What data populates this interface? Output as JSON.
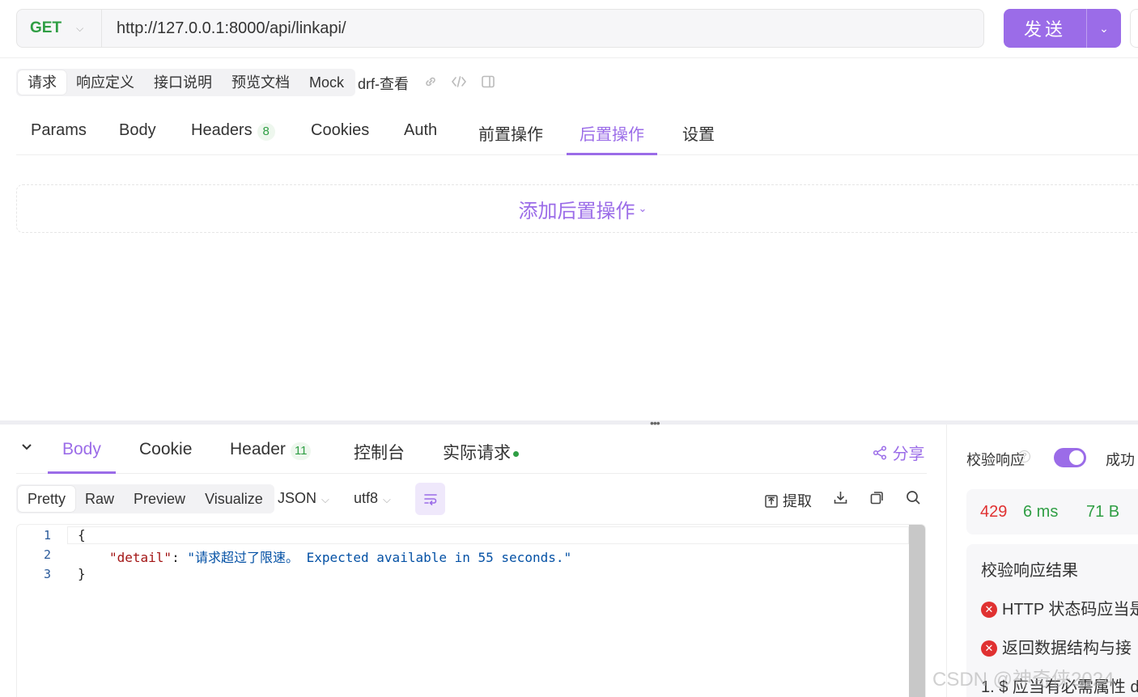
{
  "request": {
    "method": "GET",
    "url": "http://127.0.0.1:8000/api/linkapi/",
    "send_label": "发送"
  },
  "modes": [
    "请求",
    "响应定义",
    "接口说明",
    "预览文档",
    "Mock"
  ],
  "doc_name": "drf-查看",
  "req_tabs": {
    "params": "Params",
    "body": "Body",
    "headers": "Headers",
    "headers_count": "8",
    "cookies": "Cookies",
    "auth": "Auth",
    "pre": "前置操作",
    "post": "后置操作",
    "settings": "设置"
  },
  "add_post_action": "添加后置操作",
  "res_tabs": {
    "body": "Body",
    "cookie": "Cookie",
    "header": "Header",
    "header_count": "11",
    "console": "控制台",
    "actual": "实际请求",
    "share": "分享"
  },
  "views": [
    "Pretty",
    "Raw",
    "Preview",
    "Visualize"
  ],
  "format": "JSON",
  "encoding": "utf8",
  "extract": "提取",
  "code": {
    "line_numbers": [
      "1",
      "2",
      "3"
    ],
    "open": "{",
    "key": "\"detail\"",
    "colon": ": ",
    "value": "\"请求超过了限速。 Expected available in 55 seconds.\"",
    "close": "}"
  },
  "validation": {
    "label": "校验响应",
    "mode": "成功",
    "status": "429",
    "time": "6 ms",
    "size": "71 B",
    "result_title": "校验响应结果",
    "errors": [
      "HTTP 状态码应当是",
      "返回数据结构与接"
    ],
    "detail": "1. $ 应当有必需属性 d"
  },
  "watermark": "CSDN @神奇侠2024",
  "colors": {
    "accent": "#9b6ce8",
    "green": "#2f9e44",
    "red": "#e03131"
  }
}
